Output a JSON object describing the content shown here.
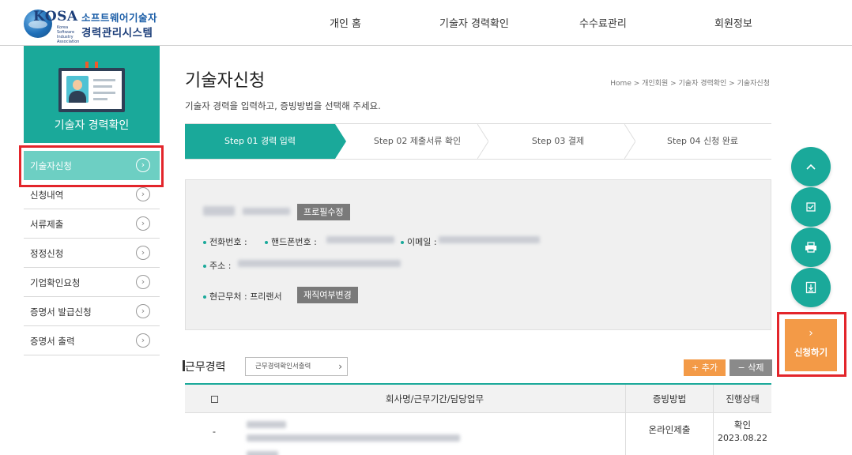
{
  "header": {
    "logo": {
      "brand": "KOSA",
      "sub": "Korea Software Industry Association",
      "line1": "소프트웨어기술자",
      "line2": "경력관리시스템"
    },
    "nav": [
      "개인 홈",
      "기술자 경력확인",
      "수수료관리",
      "회원정보"
    ]
  },
  "sidebar": {
    "title": "기술자 경력확인",
    "items": [
      {
        "label": "기술자신청"
      },
      {
        "label": "신청내역"
      },
      {
        "label": "서류제출"
      },
      {
        "label": "정정신청"
      },
      {
        "label": "기업확인요청"
      },
      {
        "label": "증명서 발급신청"
      },
      {
        "label": "증명서 출력"
      }
    ]
  },
  "main": {
    "title": "기술자신청",
    "breadcrumb": "Home > 개인회원 > 기술자 경력확인 > 기술자신청",
    "description": "기술자 경력을 입력하고, 증빙방법을 선택해 주세요.",
    "steps": [
      "Step 01 경력 입력",
      "Step 02 제출서류 확인",
      "Step 03 결제",
      "Step 04 신청 완료"
    ],
    "profile": {
      "edit_button": "프로필수정",
      "phone_label": "전화번호 :",
      "mobile_label": "핸드폰번호 :",
      "email_label": "이메일 :",
      "address_label": "주소 :",
      "workplace_label": "현근무처 :",
      "workplace_value": "프리랜서",
      "employment_button": "재직여부변경"
    },
    "career": {
      "title": "근무경력",
      "print_button": "근무경력확인서출력",
      "add_button": "+ 추가",
      "delete_button": "− 삭제",
      "columns": [
        "회사명/근무기간/담당업무",
        "증빙방법",
        "진행상태"
      ],
      "rows": [
        {
          "marker": "-",
          "method": "온라인제출",
          "status": "확인",
          "date": "2023.08.22"
        }
      ]
    }
  },
  "floating": {
    "apply_label": "신청하기",
    "apply_chevron": "›"
  }
}
